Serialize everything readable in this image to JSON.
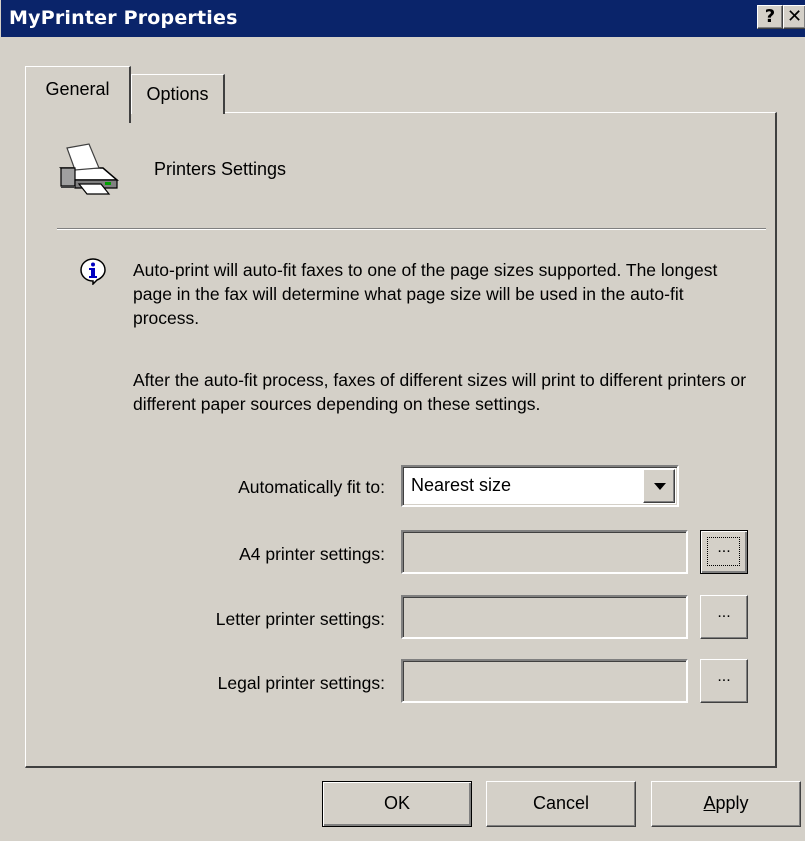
{
  "window": {
    "title": "MyPrinter Properties",
    "help_label": "?",
    "close_label": "✕",
    "title_bar_color": "#0a246a",
    "face_color": "#d4d0c8"
  },
  "tabs": [
    {
      "label": "General",
      "selected": true
    },
    {
      "label": "Options",
      "selected": false
    }
  ],
  "general": {
    "heading": "Printers Settings",
    "info_text_1": "Auto-print will auto-fit faxes to one of the page sizes supported. The longest page in the fax will determine what page size will be used in the auto-fit process.",
    "info_text_2": "After the auto-fit process, faxes of different sizes will print to different printers or different paper sources depending on these settings.",
    "fit_label": "Automatically fit to:",
    "fit_value": "Nearest size",
    "a4_label": "A4 printer settings:",
    "a4_value": "",
    "letter_label": "Letter printer settings:",
    "letter_value": "",
    "legal_label": "Legal printer settings:",
    "legal_value": "",
    "browse_label": "..."
  },
  "buttons": {
    "ok": "OK",
    "cancel": "Cancel",
    "apply_mnemonic": "A",
    "apply_rest": "pply"
  }
}
